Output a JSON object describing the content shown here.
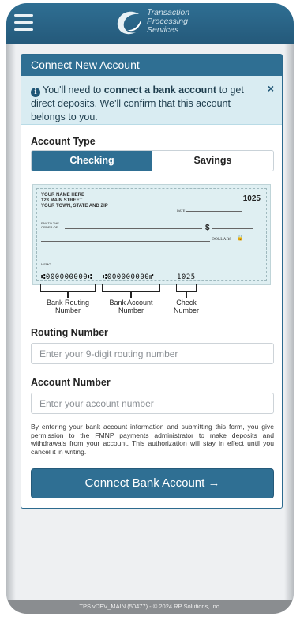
{
  "header": {
    "logo_line1": "Transaction",
    "logo_line2": "Processing",
    "logo_line3": "Services",
    "menu_icon": "hamburger-icon",
    "logo_icon": "tps-swoosh-logo"
  },
  "card": {
    "title": "Connect New Account",
    "alert": {
      "icon": "info-icon",
      "text_before": "You'll need to ",
      "text_bold": "connect a bank account",
      "text_after": " to get direct deposits. We'll confirm that this account belongs to you.",
      "close_symbol": "×"
    },
    "account_type_label": "Account Type",
    "account_types": [
      "Checking",
      "Savings"
    ],
    "selected_account_type": "Checking",
    "check": {
      "name_line": "YOUR NAME HERE",
      "street_line": "123 MAIN STREET",
      "city_line": "YOUR TOWN, STATE AND ZIP",
      "check_number": "1025",
      "date_label": "DATE",
      "pay_to_label": "PAY TO THE ORDER OF",
      "dollar_sign": "$",
      "dollars_label": "DOLLARS",
      "memo_label": "MEMO",
      "micr_routing": "⑆000000000⑆",
      "micr_account": "⑆000000000⑈",
      "micr_check": "1025"
    },
    "check_labels": {
      "routing": [
        "Bank Routing",
        "Number"
      ],
      "account": [
        "Bank Account",
        "Number"
      ],
      "check": [
        "Check",
        "Number"
      ]
    },
    "routing_label": "Routing Number",
    "routing_placeholder": "Enter your 9-digit routing number",
    "routing_value": "",
    "account_label": "Account Number",
    "account_placeholder": "Enter your account number",
    "account_value": "",
    "legal_text": "By entering your bank account information and submitting this form, you give permission to the FMNP payments administrator to make deposits and withdrawals from your account. This authorization will stay in effect until you cancel it in writing.",
    "submit_label": "Connect Bank Account",
    "submit_arrow": "→"
  },
  "footer": {
    "text": "TPS vDEV_MAIN (50477) - © 2024 RP Solutions, Inc."
  },
  "colors": {
    "primary": "#2f6f93",
    "alert_bg": "#d9ecf2",
    "check_bg": "#dfeff2"
  }
}
